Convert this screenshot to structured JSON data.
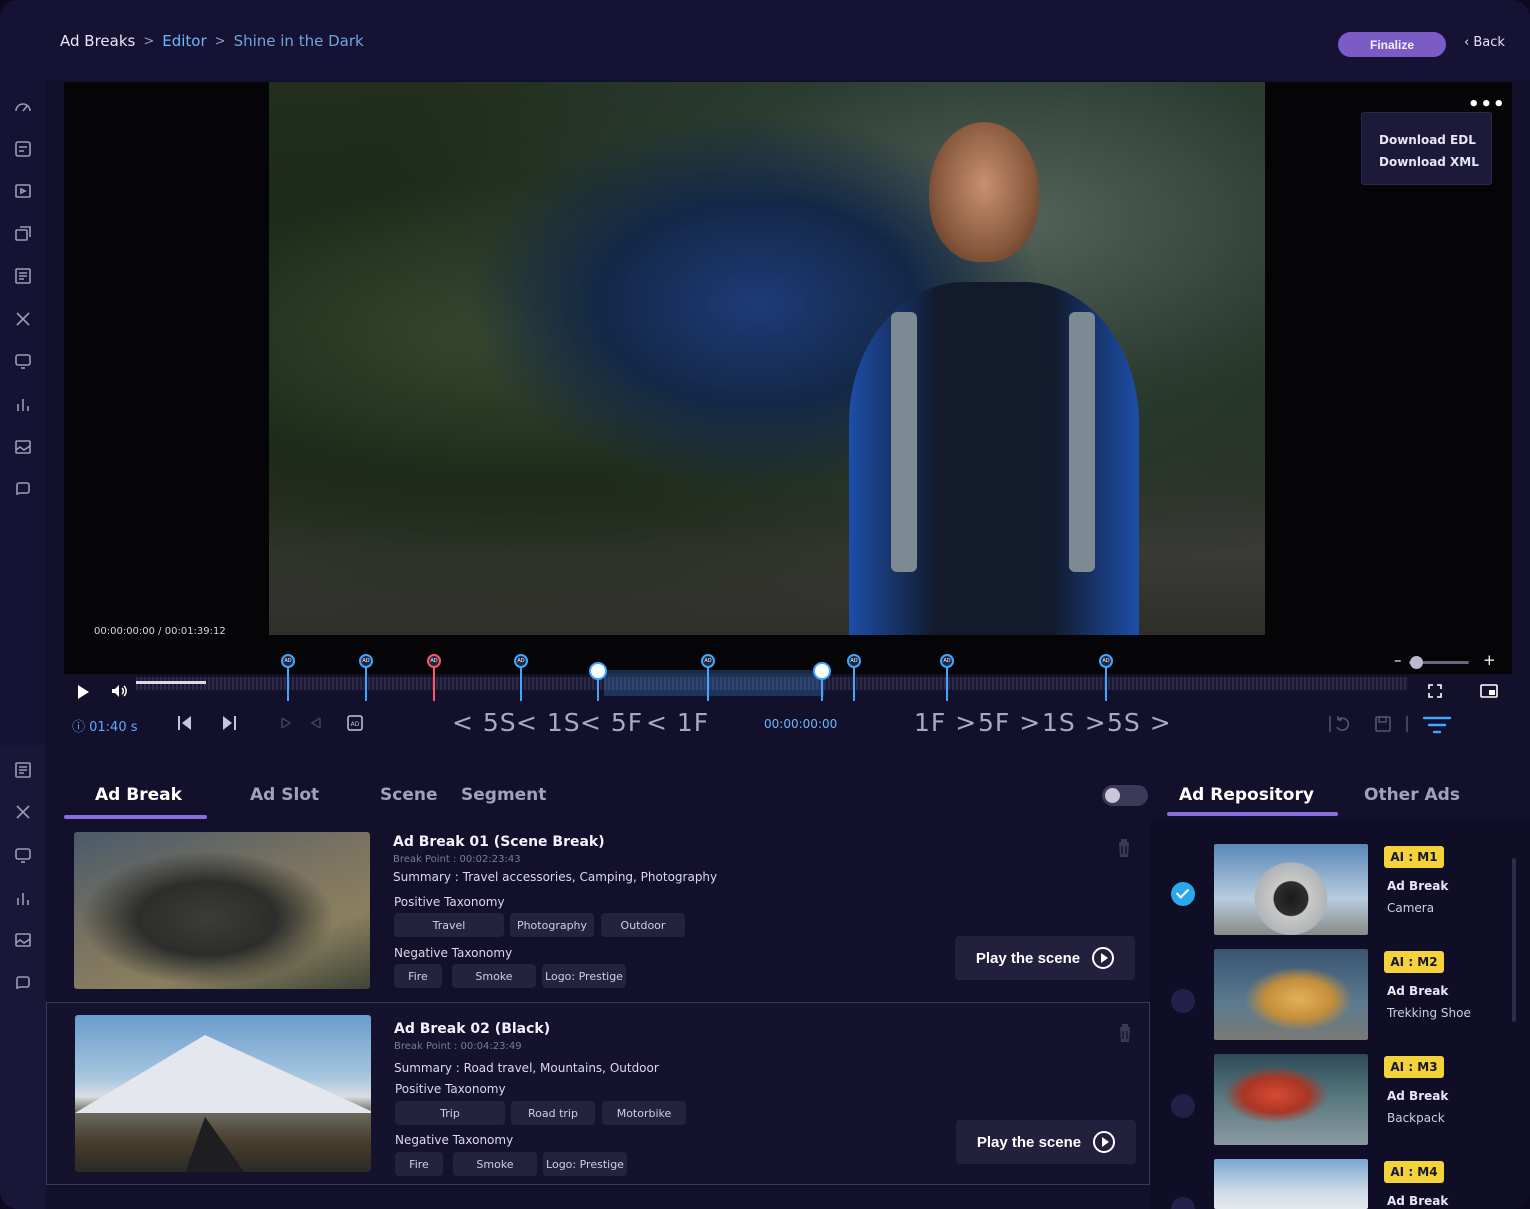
{
  "breadcrumb": {
    "root": "Ad Breaks",
    "sep": ">",
    "section": "Editor",
    "title": "Shine in the Dark"
  },
  "header": {
    "finalize_label": "Finalize",
    "back_label": "‹ Back"
  },
  "video": {
    "menu_icon": "more-dots-icon",
    "menu_dots": "•••",
    "download_menu": [
      "Download EDL",
      "Download XML"
    ],
    "timecode": "00:00:00:00 / 00:01:39:12",
    "zoom_minus": "–",
    "zoom_plus": "+"
  },
  "timeline": {
    "marker_label": "AD",
    "progress_fraction": 0.055
  },
  "controls": {
    "duration": "ⓘ 01:40 s",
    "steps_back": [
      "< 5S",
      "< 1S",
      "< 5F",
      "< 1F"
    ],
    "steps_fwd": [
      "1F >",
      "5F >",
      "1S >",
      "5S >"
    ],
    "current_time": "00:00:00:00"
  },
  "tabs": [
    "Ad Break",
    "Ad Slot",
    "Scene",
    "Segment"
  ],
  "repo_tabs": [
    "Ad Repository",
    "Other Ads"
  ],
  "ad_breaks": [
    {
      "title": "Ad Break  01 (Scene Break)",
      "break_point": "Break Point : 00:02:23:43",
      "summary": "Summary : Travel accessories, Camping, Photography",
      "positive_label": "Positive Taxonomy",
      "positive": [
        "Travel",
        "Photography",
        "Outdoor"
      ],
      "negative_label": "Negative Taxonomy",
      "negative": [
        "Fire",
        "Smoke",
        "Logo: Prestige"
      ],
      "play_label": "Play the scene"
    },
    {
      "title": "Ad Break  02 (Black)",
      "break_point": "Break Point : 00:04:23:49",
      "summary": "Summary : Road travel, Mountains, Outdoor",
      "positive_label": "Positive Taxonomy",
      "positive": [
        "Trip",
        "Road trip",
        "Motorbike"
      ],
      "negative_label": "Negative Taxonomy",
      "negative": [
        "Fire",
        "Smoke",
        "Logo: Prestige"
      ],
      "play_label": "Play the scene"
    }
  ],
  "repository": [
    {
      "badge": "AI : M1",
      "type": "Ad Break",
      "name": "Camera",
      "selected": true
    },
    {
      "badge": "AI : M2",
      "type": "Ad Break",
      "name": "Trekking Shoe",
      "selected": false
    },
    {
      "badge": "AI : M3",
      "type": "Ad Break",
      "name": "Backpack",
      "selected": false
    },
    {
      "badge": "AI : M4",
      "type": "Ad Break",
      "name": "",
      "selected": false
    }
  ],
  "colors": {
    "accent": "#7a5cc4",
    "link": "#6cb6ff",
    "marker": "#41a6ff",
    "marker_alert": "#ff5566",
    "badge": "#f3d23a"
  }
}
